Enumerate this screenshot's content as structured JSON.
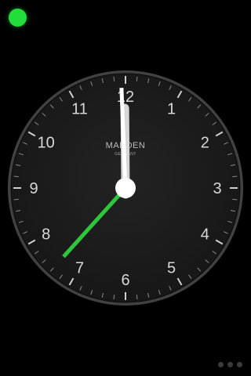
{
  "status": {
    "indicator_color": "#22dd3a",
    "icon": "green-status-dot"
  },
  "clock": {
    "brand": "MARDEN",
    "brand_sub": "GERMANY",
    "numerals": [
      "12",
      "1",
      "2",
      "3",
      "4",
      "5",
      "6",
      "7",
      "8",
      "9",
      "10",
      "11"
    ],
    "time": {
      "hour": 11,
      "minute": 59,
      "second": 37
    },
    "colors": {
      "face": "#1b1b1b",
      "bezel": "#3a3a3a",
      "numerals": "#d8d8d8",
      "hour_hand": "#d6d6d6",
      "minute_hand": "#ffffff",
      "second_hand": "#2fc53d",
      "hub": "#ffffff"
    }
  },
  "pager": {
    "page_count": 3
  }
}
